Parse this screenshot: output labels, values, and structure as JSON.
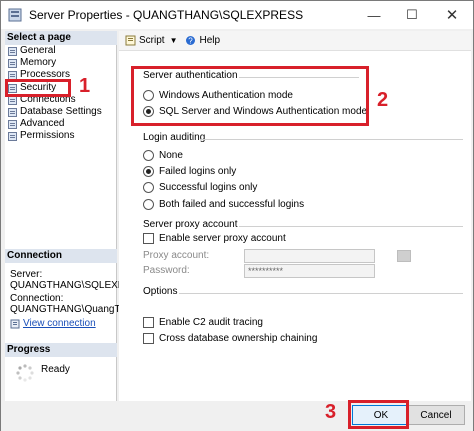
{
  "window": {
    "title": "Server Properties - QUANGTHANG\\SQLEXPRESS",
    "minimize": "—",
    "maximize": "☐",
    "close": "✕"
  },
  "sidebar": {
    "select_page_title": "Select a page",
    "items": [
      {
        "label": "General"
      },
      {
        "label": "Memory"
      },
      {
        "label": "Processors"
      },
      {
        "label": "Security"
      },
      {
        "label": "Connections"
      },
      {
        "label": "Database Settings"
      },
      {
        "label": "Advanced"
      },
      {
        "label": "Permissions"
      }
    ],
    "connection_title": "Connection",
    "server_label": "Server:",
    "server_value": "QUANGTHANG\\SQLEXPRESS",
    "connection_label": "Connection:",
    "connection_value": "QUANGTHANG\\QuangTha",
    "view_connection": "View connection",
    "progress_title": "Progress",
    "ready": "Ready"
  },
  "toolbar": {
    "script": "Script",
    "help": "Help"
  },
  "server_auth": {
    "title": "Server authentication",
    "options": [
      {
        "label": "Windows Authentication mode",
        "selected": false
      },
      {
        "label": "SQL Server and Windows Authentication mode",
        "selected": true
      }
    ]
  },
  "login_auditing": {
    "title": "Login auditing",
    "options": [
      {
        "label": "None",
        "selected": false
      },
      {
        "label": "Failed logins only",
        "selected": true
      },
      {
        "label": "Successful logins only",
        "selected": false
      },
      {
        "label": "Both failed and successful logins",
        "selected": false
      }
    ]
  },
  "proxy": {
    "title": "Server proxy account",
    "enable_label": "Enable server proxy account",
    "proxy_account_label": "Proxy account:",
    "proxy_account_value": "",
    "password_label": "Password:",
    "password_value": "**********"
  },
  "options": {
    "title": "Options",
    "c2_audit": "Enable C2 audit tracing",
    "cross_db": "Cross database ownership chaining"
  },
  "buttons": {
    "ok": "OK",
    "cancel": "Cancel"
  },
  "annotations": {
    "n1": "1",
    "n2": "2",
    "n3": "3"
  },
  "colors": {
    "annotation_red": "#d8202a",
    "link_blue": "#1a4fb8"
  }
}
